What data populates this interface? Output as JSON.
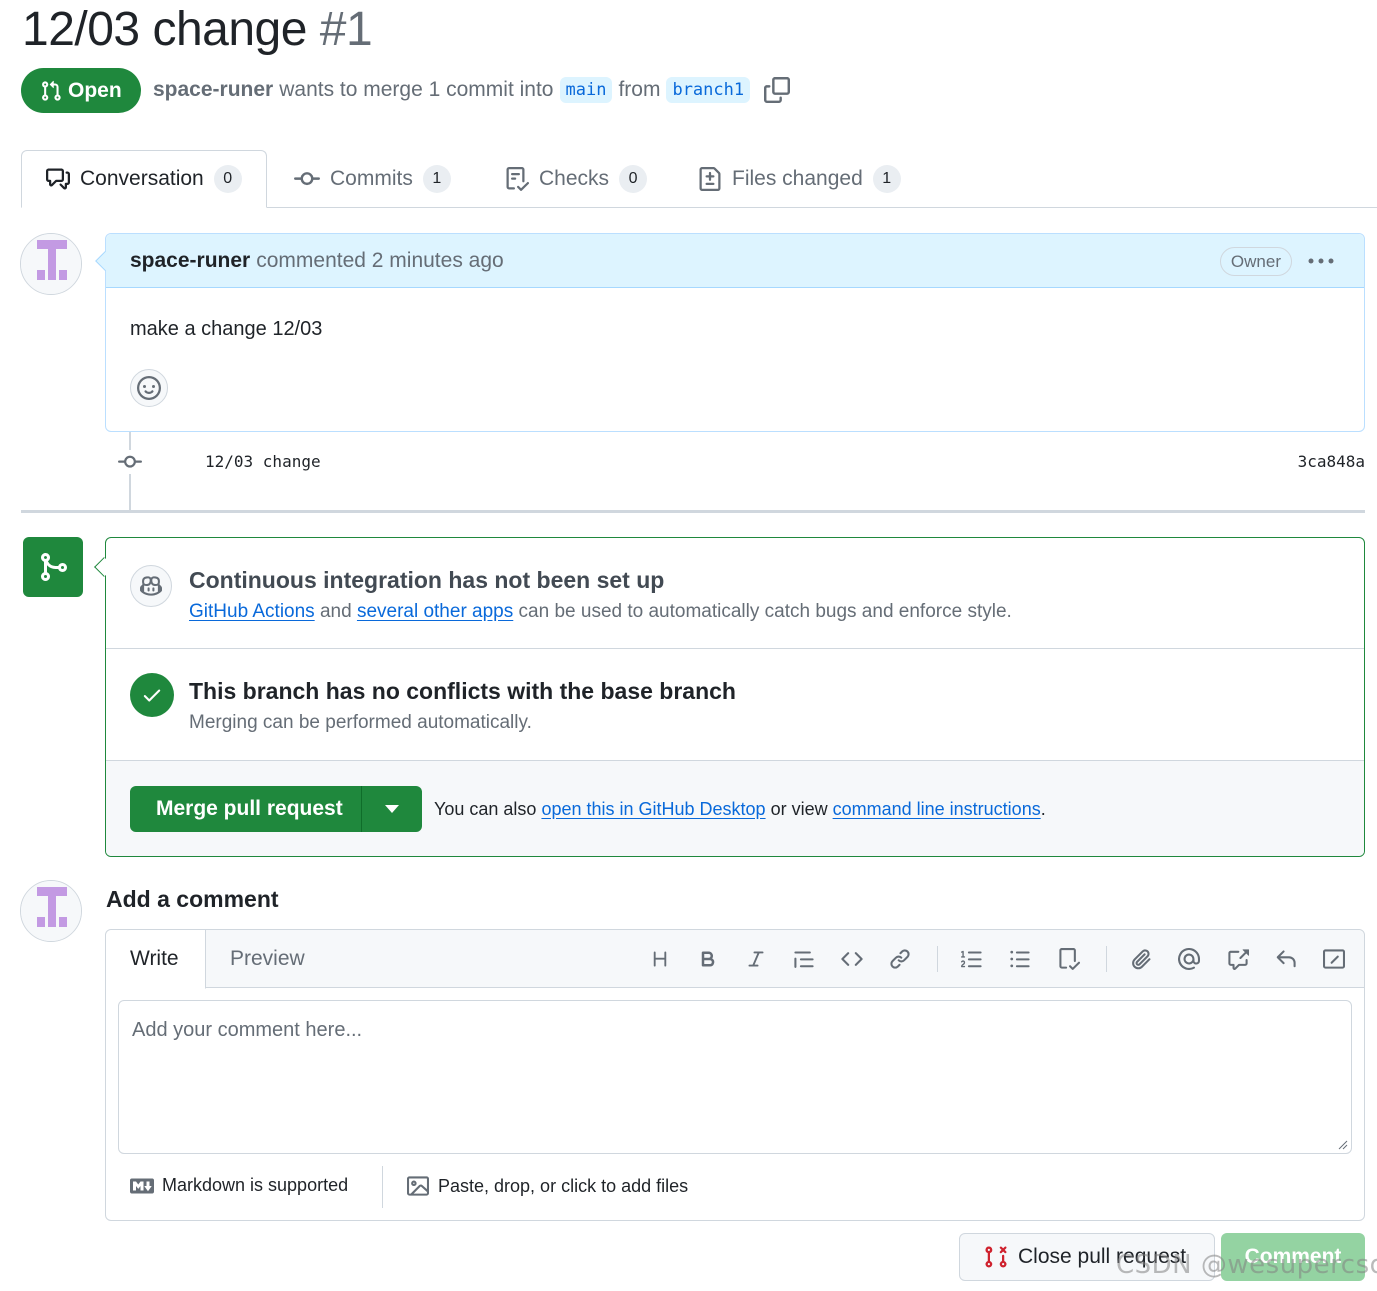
{
  "header": {
    "title": "12/03 change",
    "number": "#1",
    "state": "Open",
    "author": "space-runer",
    "merge_text": "wants to merge 1 commit into",
    "base_branch": "main",
    "from_text": "from",
    "head_branch": "branch1"
  },
  "tabs": [
    {
      "label": "Conversation",
      "count": "0",
      "icon": "comment-discussion-icon"
    },
    {
      "label": "Commits",
      "count": "1",
      "icon": "git-commit-icon"
    },
    {
      "label": "Checks",
      "count": "0",
      "icon": "checklist-icon"
    },
    {
      "label": "Files changed",
      "count": "1",
      "icon": "file-diff-icon"
    }
  ],
  "comment": {
    "author": "space-runer",
    "action": "commented",
    "time": "2 minutes ago",
    "role_badge": "Owner",
    "body": "make a change 12/03"
  },
  "commit": {
    "message": "12/03 change",
    "sha": "3ca848a"
  },
  "merge_box": {
    "ci_title": "Continuous integration has not been set up",
    "ci_link1": "GitHub Actions",
    "ci_and": "and",
    "ci_link2": "several other apps",
    "ci_rest": "can be used to automatically catch bugs and enforce style.",
    "conflict_title": "This branch has no conflicts with the base branch",
    "conflict_sub": "Merging can be performed automatically.",
    "merge_button": "Merge pull request",
    "also_text": "You can also",
    "also_link1": "open this in GitHub Desktop",
    "also_or": "or view",
    "also_link2": "command line instructions",
    "also_end": "."
  },
  "add_comment": {
    "heading": "Add a comment",
    "tab_write": "Write",
    "tab_preview": "Preview",
    "toolbar": [
      "heading-icon",
      "bold-icon",
      "italic-icon",
      "quote-icon",
      "code-icon",
      "link-icon",
      "ordered-list-icon",
      "unordered-list-icon",
      "task-list-icon",
      "attach-icon",
      "mention-icon",
      "cross-reference-icon",
      "reply-icon",
      "fullscreen-icon"
    ],
    "placeholder": "Add your comment here...",
    "markdown_note": "Markdown is supported",
    "files_note": "Paste, drop, or click to add files"
  },
  "buttons": {
    "close": "Close pull request",
    "comment": "Comment"
  },
  "watermark": "CSDN @wesupercsdn",
  "colors": {
    "accent_green": "#1f883d",
    "link_blue": "#0969da",
    "comment_header_bg": "#ddf4ff",
    "close_icon_red": "#cf222e"
  }
}
